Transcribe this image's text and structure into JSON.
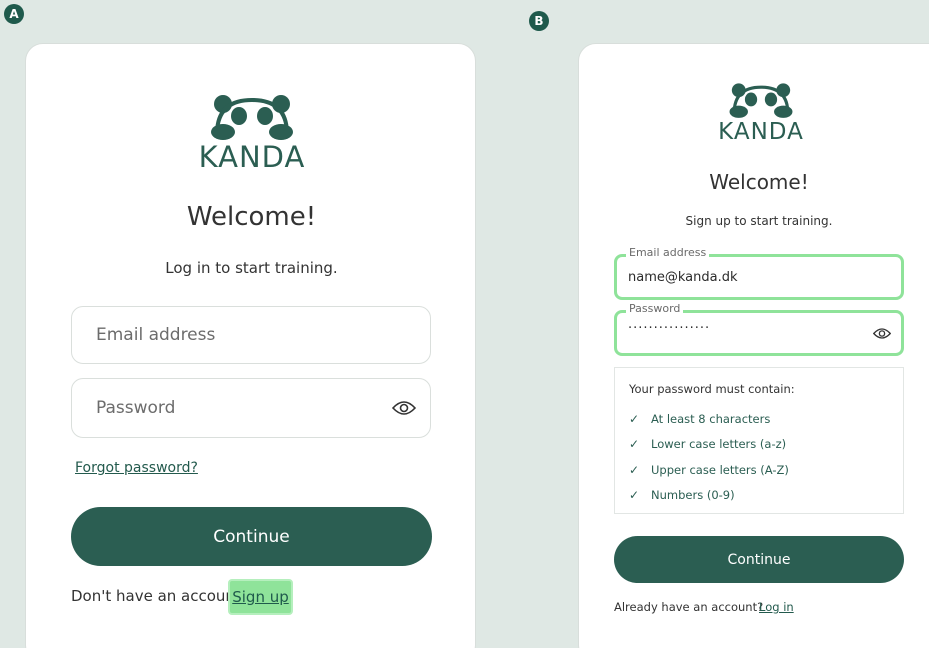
{
  "badges": {
    "a": "A",
    "b": "B"
  },
  "brand": {
    "name": "KANDA",
    "color": "#2b5e52",
    "accent_green": "#8fe39a"
  },
  "login": {
    "title": "Welcome!",
    "subtitle": "Log in to start training.",
    "email_placeholder": "Email address",
    "password_placeholder": "Password",
    "forgot_link": "Forgot password?",
    "continue_label": "Continue",
    "no_account_text": "Don't have an account?",
    "signup_link": "Sign up"
  },
  "signup": {
    "title": "Welcome!",
    "subtitle": "Sign up to start training.",
    "email_label": "Email address",
    "email_value": "name@kanda.dk",
    "password_label": "Password",
    "password_masked": "················",
    "rules_title": "Your password must contain:",
    "rules": [
      {
        "check": "✓",
        "text": "At least 8 characters"
      },
      {
        "check": "✓",
        "text": "Lower case letters (a-z)"
      },
      {
        "check": "✓",
        "text": "Upper case letters (A-Z)"
      },
      {
        "check": "✓",
        "text": "Numbers (0-9)"
      }
    ],
    "continue_label": "Continue",
    "have_account_text": "Already have an account?",
    "login_link": "Log in"
  }
}
